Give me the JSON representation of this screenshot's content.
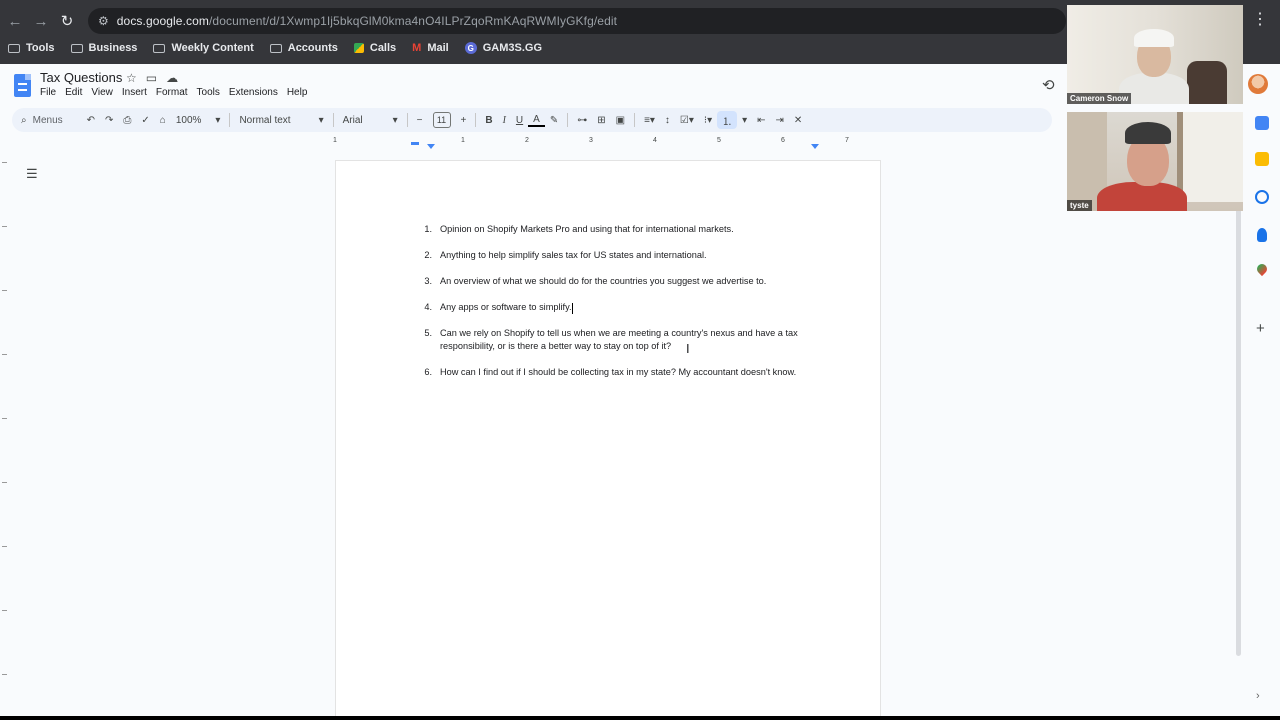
{
  "browser": {
    "url_host": "docs.google.com",
    "url_path": "/document/d/1Xwmp1Ij5bkqGlM0kma4nO4ILPrZqoRmKAqRWMIyGKfg/edit",
    "bookmarks": [
      {
        "label": "Tools",
        "icon": "folder-icon"
      },
      {
        "label": "Business",
        "icon": "folder-icon"
      },
      {
        "label": "Weekly Content",
        "icon": "folder-icon"
      },
      {
        "label": "Accounts",
        "icon": "folder-icon"
      },
      {
        "label": "Calls",
        "icon": "calls-icon"
      },
      {
        "label": "Mail",
        "icon": "gmail-icon"
      },
      {
        "label": "GAM3S.GG",
        "icon": "gam3s-icon"
      }
    ]
  },
  "doc": {
    "title": "Tax Questions",
    "menu": [
      "File",
      "Edit",
      "View",
      "Insert",
      "Format",
      "Tools",
      "Extensions",
      "Help"
    ]
  },
  "toolbar": {
    "menus_label": "Menus",
    "zoom": "100%",
    "style": "Normal text",
    "font": "Arial",
    "font_size": "11",
    "bold": "B",
    "italic": "I",
    "underline": "U",
    "text_color": "A"
  },
  "ruler": [
    "1",
    "1",
    "2",
    "3",
    "4",
    "5",
    "6",
    "7"
  ],
  "questions": [
    {
      "num": "1.",
      "text": "Opinion on Shopify Markets Pro and using that for international markets."
    },
    {
      "num": "2.",
      "text": "Anything to help simplify sales tax for US states and international."
    },
    {
      "num": "3.",
      "text": "An overview of what we should do for the countries you suggest we advertise to."
    },
    {
      "num": "4.",
      "text": "Any apps or software to simplify."
    },
    {
      "num": "5.",
      "text": "Can we rely on Shopify to tell us when we are meeting a country's nexus and have a tax responsibility, or is there a better way to stay on top of it?"
    },
    {
      "num": "6.",
      "text": "How can I find out if I should be collecting tax in my state? My accountant doesn't know."
    }
  ],
  "video": {
    "participant_1": "Cameron Snow",
    "participant_2": "tyste"
  },
  "colors": {
    "chrome_bg": "#35363a",
    "docs_blue": "#4285f4",
    "toolbar_bg": "#edf2fa"
  }
}
